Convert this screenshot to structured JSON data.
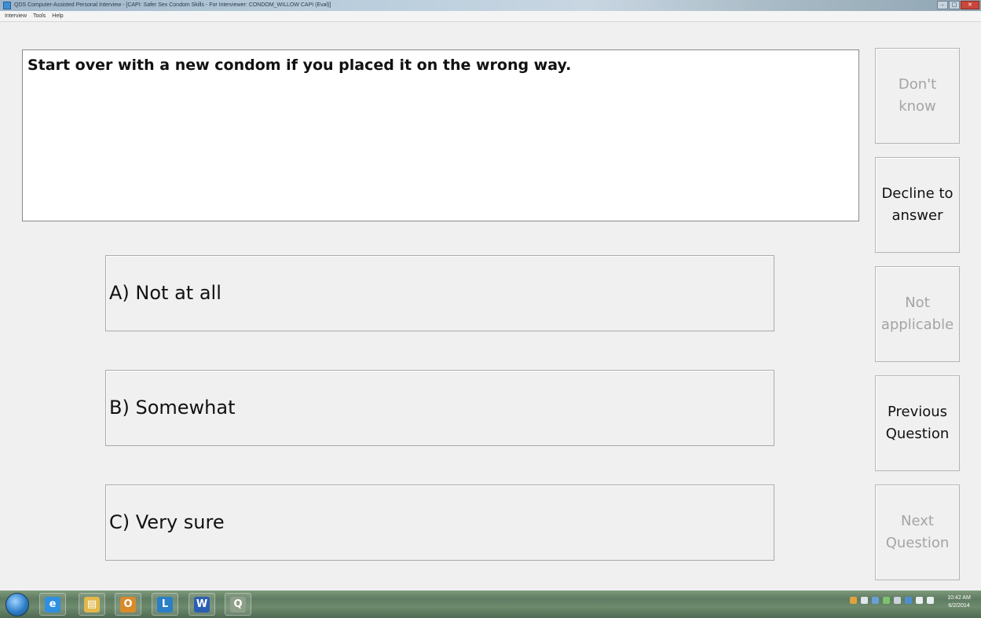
{
  "window": {
    "title": "QDS Computer-Assisted Personal Interview - [CAPI: Safer Sex Condom Skills - For Interviewer: CONDOM_WILLOW CAPI (Eval)]",
    "controls": {
      "minimize": "–",
      "maximize": "□",
      "close": "✕"
    }
  },
  "menu": {
    "items": [
      "Interview",
      "Tools",
      "Help"
    ]
  },
  "question": {
    "text": "Start over with a new condom if you placed it on the wrong way."
  },
  "answers": [
    {
      "label": "A) Not at all"
    },
    {
      "label": "B) Somewhat"
    },
    {
      "label": "C) Very sure"
    }
  ],
  "side_buttons": [
    {
      "label": "Don't\nknow",
      "enabled": false
    },
    {
      "label": "Decline to\nanswer",
      "enabled": true
    },
    {
      "label": "Not\napplicable",
      "enabled": false
    },
    {
      "label": "Previous\nQuestion",
      "enabled": true
    },
    {
      "label": "Next\nQuestion",
      "enabled": false
    }
  ],
  "taskbar": {
    "apps": [
      {
        "icon": "internet-explorer-icon",
        "glyph": "e",
        "color": "#2f8fe0"
      },
      {
        "icon": "file-explorer-icon",
        "glyph": "▤",
        "color": "#e2b84a"
      },
      {
        "icon": "outlook-icon",
        "glyph": "O",
        "color": "#d98a2b"
      },
      {
        "icon": "lync-icon",
        "glyph": "L",
        "color": "#2a7fc7"
      },
      {
        "icon": "word-icon",
        "glyph": "W",
        "color": "#2b5fb3"
      },
      {
        "icon": "qds-app-icon",
        "glyph": "Q",
        "color": "#8fa08a"
      }
    ],
    "clock_time": "10:42 AM",
    "clock_date": "6/2/2014"
  }
}
